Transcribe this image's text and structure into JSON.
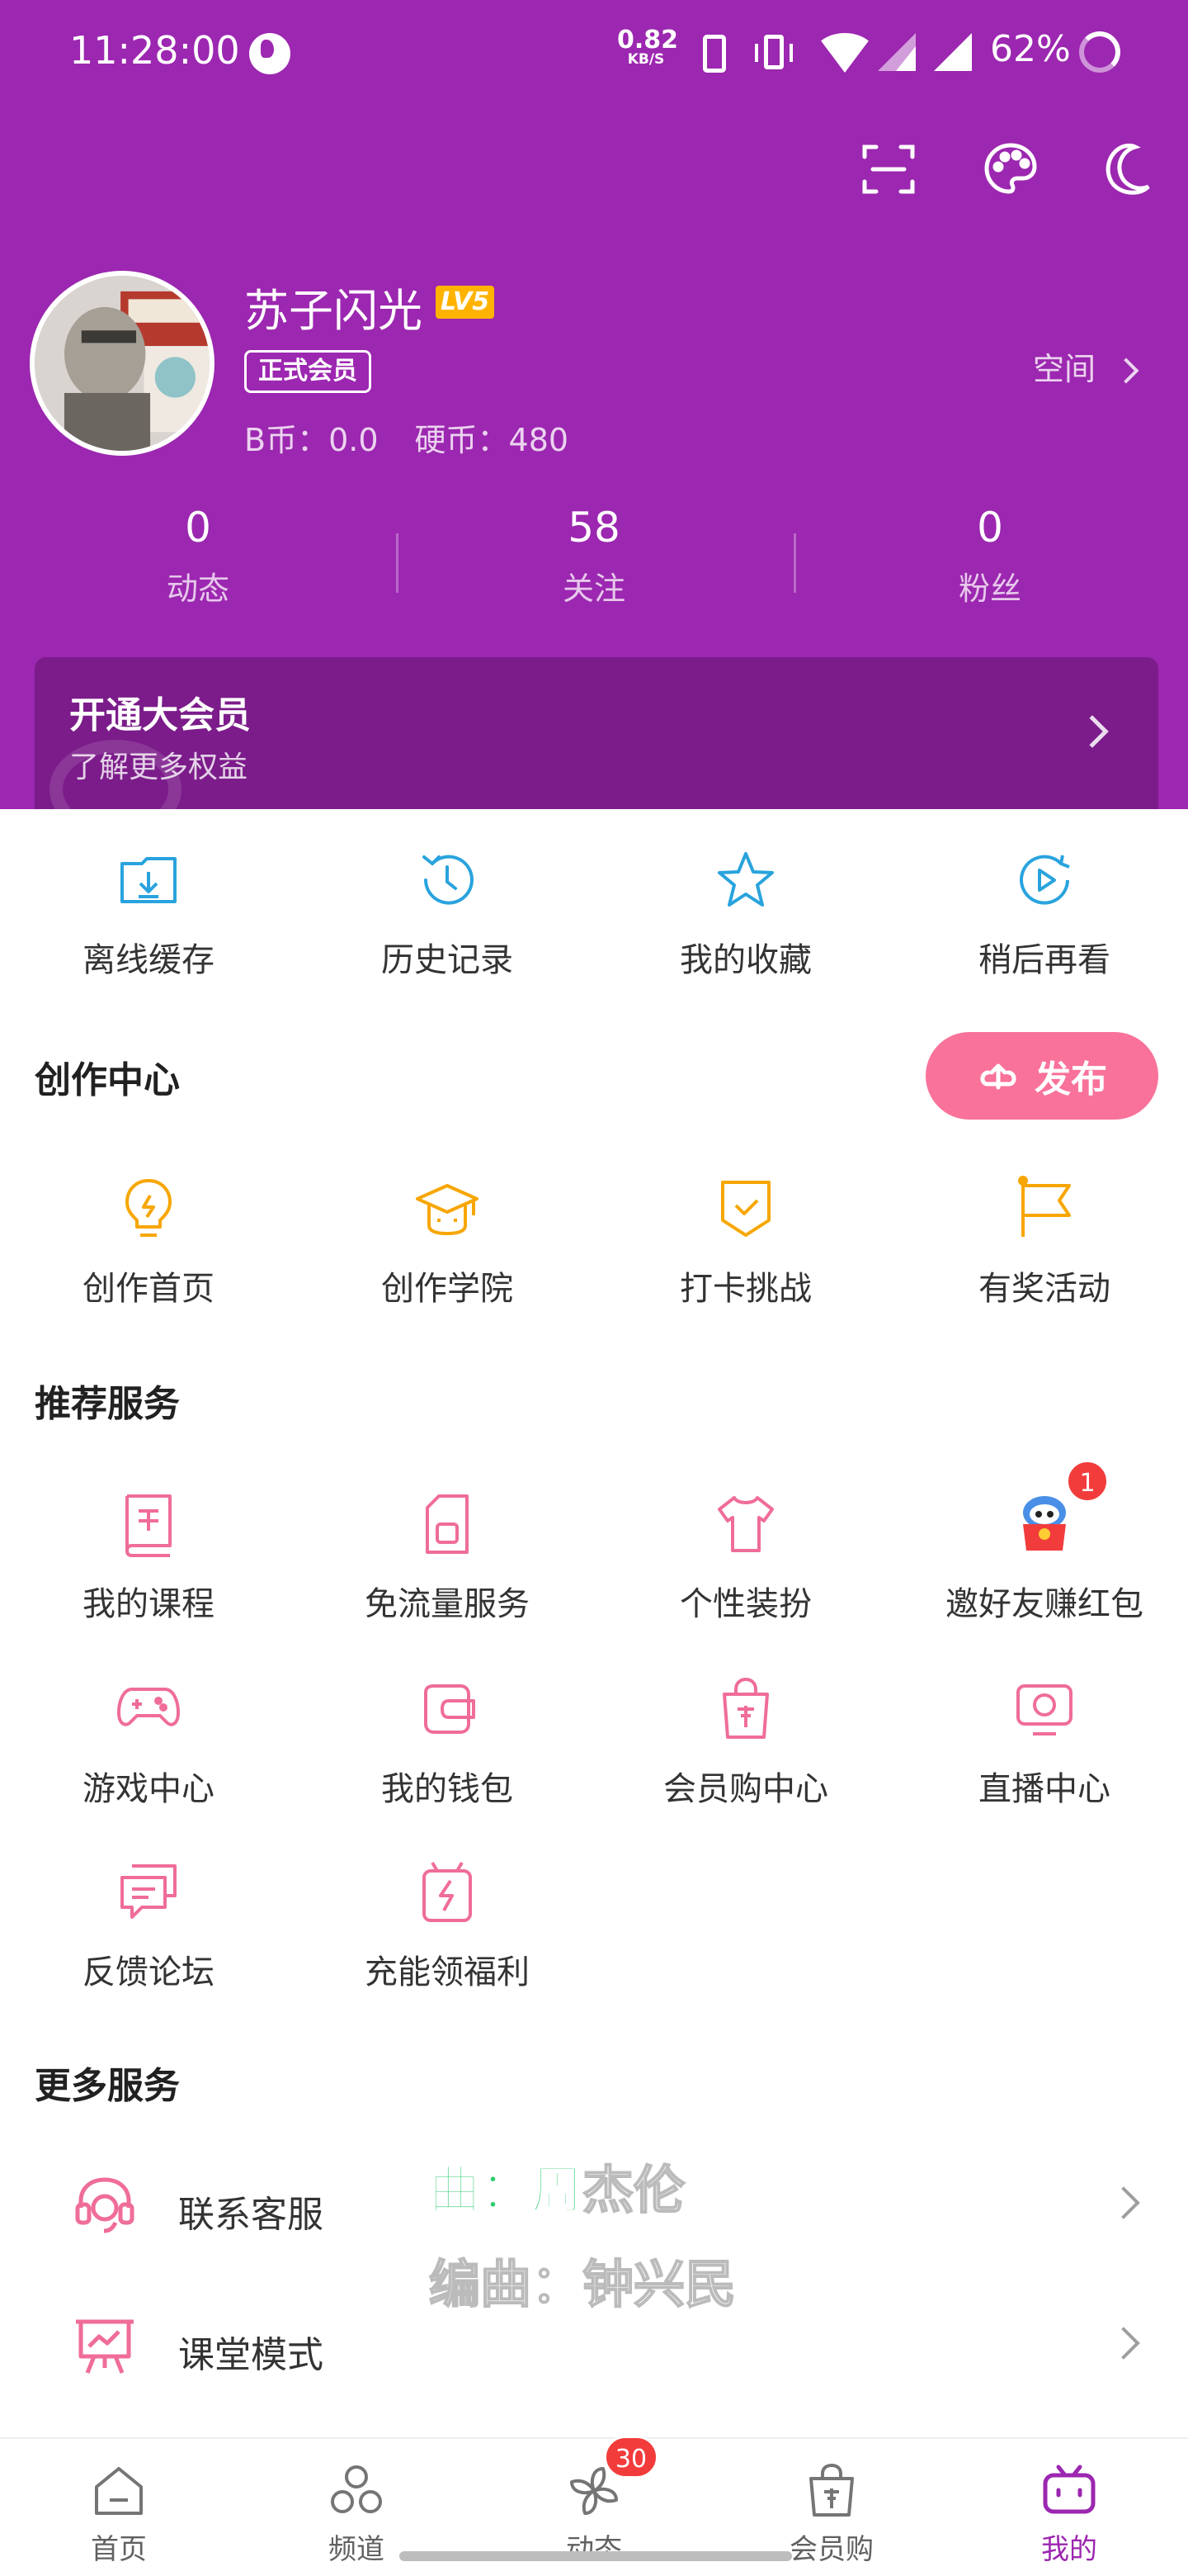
{
  "status_bar": {
    "time": "11:28:00",
    "net_speed": "0.82",
    "net_unit": "KB/S",
    "battery": "62%"
  },
  "profile": {
    "username": "苏子闪光",
    "level": "LV5",
    "member_tag": "正式会员",
    "b_coins": "B币：0.0",
    "hard_coins": "硬币：480",
    "space_label": "空间"
  },
  "stats": [
    {
      "value": "0",
      "label": "动态"
    },
    {
      "value": "58",
      "label": "关注"
    },
    {
      "value": "0",
      "label": "粉丝"
    }
  ],
  "vip": {
    "title": "开通大会员",
    "subtitle": "了解更多权益"
  },
  "quick_actions": [
    {
      "label": "离线缓存",
      "icon": "offline-cache-icon"
    },
    {
      "label": "历史记录",
      "icon": "history-icon"
    },
    {
      "label": "我的收藏",
      "icon": "star-icon"
    },
    {
      "label": "稍后再看",
      "icon": "watch-later-icon"
    }
  ],
  "creation": {
    "title": "创作中心",
    "publish_label": "发布",
    "items": [
      {
        "label": "创作首页",
        "icon": "lightbulb-icon"
      },
      {
        "label": "创作学院",
        "icon": "graduation-cap-icon"
      },
      {
        "label": "打卡挑战",
        "icon": "checkin-shield-icon"
      },
      {
        "label": "有奖活动",
        "icon": "flag-icon"
      }
    ]
  },
  "recommended": {
    "title": "推荐服务",
    "items": [
      {
        "label": "我的课程",
        "icon": "course-book-icon"
      },
      {
        "label": "免流量服务",
        "icon": "sim-card-icon"
      },
      {
        "label": "个性装扮",
        "icon": "tshirt-icon"
      },
      {
        "label": "邀好友赚红包",
        "icon": "red-packet-mascot-icon",
        "badge": "1"
      },
      {
        "label": "游戏中心",
        "icon": "gamepad-icon"
      },
      {
        "label": "我的钱包",
        "icon": "wallet-icon"
      },
      {
        "label": "会员购中心",
        "icon": "shopping-bag-icon"
      },
      {
        "label": "直播中心",
        "icon": "live-tv-icon"
      },
      {
        "label": "反馈论坛",
        "icon": "feedback-chat-icon"
      },
      {
        "label": "充能领福利",
        "icon": "battery-charge-icon"
      }
    ]
  },
  "more": {
    "title": "更多服务",
    "items": [
      {
        "label": "联系客服",
        "icon": "headset-icon"
      },
      {
        "label": "课堂模式",
        "icon": "classroom-board-icon"
      }
    ]
  },
  "lyrics": {
    "line1_hl": "曲：周",
    "line1_rest": "杰伦",
    "line2": "编曲：钟兴民"
  },
  "bottom_nav": [
    {
      "label": "首页",
      "icon": "home-icon"
    },
    {
      "label": "频道",
      "icon": "channel-icon"
    },
    {
      "label": "动态",
      "icon": "pinwheel-icon",
      "badge": "30"
    },
    {
      "label": "会员购",
      "icon": "shop-bag-icon"
    },
    {
      "label": "我的",
      "icon": "tv-mine-icon",
      "active": true
    }
  ],
  "colors": {
    "header_purple": "#9c27b0",
    "accent_pink": "#f8729a",
    "icon_blue": "#29a3dd",
    "icon_orange": "#f7a600",
    "icon_pink": "#ef6d98"
  }
}
